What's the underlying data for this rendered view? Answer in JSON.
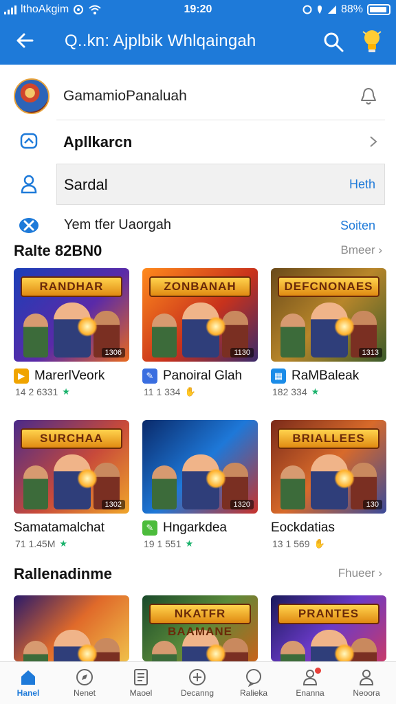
{
  "status_bar": {
    "carrier": "lthoAkgim",
    "time": "19:20",
    "battery": "88%"
  },
  "app_bar": {
    "title": "Q..kn: Ajplbik Whlqaingah"
  },
  "rows": {
    "profile_label": "GamamioPanaluah",
    "apps_label": "Apllkarcn",
    "sardal_label": "Sardal",
    "sardal_action": "Heth",
    "yem_label": "Yem tfer Uaorgah",
    "yem_action": "Soiten"
  },
  "section1": {
    "title": "Ralte 82BN0",
    "more": "Bmeer"
  },
  "section2": {
    "title": "Rallenadinme",
    "more": "Fhueer"
  },
  "colors": {
    "accent": "#1e7ad9",
    "star_green": "#19b26b",
    "star_gold": "#e6b420"
  },
  "cards": [
    {
      "name": "MarerlVeork",
      "meta": "14 2 6331",
      "badge": "1306",
      "banner": "RANDHAR",
      "badge_color": "#f0a400",
      "badge_glyph": "▶",
      "star": "★",
      "star_color": "#19b26b"
    },
    {
      "name": "Panoiral Glah",
      "meta": "11 1 334",
      "badge": "1130",
      "banner": "ZONBANAH",
      "badge_color": "#3a6ee0",
      "badge_glyph": "✎",
      "star": "✋",
      "star_color": "#e6b420"
    },
    {
      "name": "RaMBaleak",
      "meta": "182 334",
      "badge": "1313",
      "banner": "DEFCNONAES",
      "badge_color": "#1b8ce8",
      "badge_glyph": "▦",
      "star": "★",
      "star_color": "#19b26b"
    },
    {
      "name": "Samatamalchat",
      "meta": "71 1.45M",
      "badge": "1302",
      "banner": "SURCHAA",
      "badge_color": "#8a8a8a",
      "badge_glyph": "",
      "star": "★",
      "star_color": "#19b26b"
    },
    {
      "name": "Hngarkdea",
      "meta": "19 1 551",
      "badge": "1320",
      "banner": "",
      "badge_color": "#4cbc3c",
      "badge_glyph": "✎",
      "star": "★",
      "star_color": "#19b26b"
    },
    {
      "name": "Eockdatias",
      "meta": "13 1 569",
      "badge": "130",
      "banner": "BRIALLEES",
      "badge_color": "#8a8a8a",
      "badge_glyph": "",
      "star": "✋",
      "star_color": "#e6b420"
    },
    {
      "name": "",
      "meta": "",
      "badge": "",
      "banner": "",
      "badge_color": "#8a8a8a",
      "badge_glyph": "",
      "star": "",
      "star_color": "#19b26b"
    },
    {
      "name": "",
      "meta": "",
      "badge": "",
      "banner": "NKATFR BAAMANE",
      "badge_color": "#8a8a8a",
      "badge_glyph": "",
      "star": "",
      "star_color": "#19b26b"
    },
    {
      "name": "",
      "meta": "",
      "badge": "",
      "banner": "PRANTES",
      "badge_color": "#8a8a8a",
      "badge_glyph": "",
      "star": "",
      "star_color": "#19b26b"
    }
  ],
  "bottom_nav": [
    {
      "label": "Hanel",
      "icon": "home-icon",
      "active": true
    },
    {
      "label": "Nenet",
      "icon": "compass-icon",
      "active": false
    },
    {
      "label": "Maoel",
      "icon": "document-icon",
      "active": false
    },
    {
      "label": "Decanng",
      "icon": "add-circle-icon",
      "active": false
    },
    {
      "label": "Ralieka",
      "icon": "chat-icon",
      "active": false
    },
    {
      "label": "Enanna",
      "icon": "person-icon",
      "active": false
    },
    {
      "label": "Neoora",
      "icon": "profile-icon",
      "active": false
    }
  ]
}
